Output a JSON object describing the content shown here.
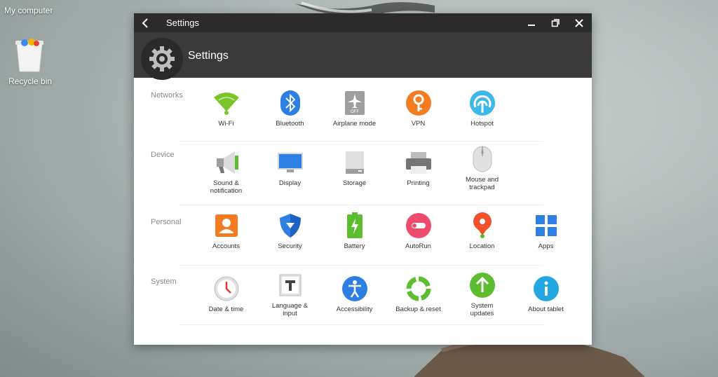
{
  "desktop": {
    "icons": [
      {
        "label": "My computer"
      },
      {
        "label": "Recycle bin"
      }
    ]
  },
  "window": {
    "title": "Settings",
    "header_title": "Settings"
  },
  "sections": [
    {
      "label": "Networks",
      "items": [
        {
          "label": "Wi-Fi",
          "icon": "wifi-icon"
        },
        {
          "label": "Bluetooth",
          "icon": "bluetooth-icon"
        },
        {
          "label": "Airplane mode",
          "icon": "airplane-mode-icon",
          "badge": "OFF"
        },
        {
          "label": "VPN",
          "icon": "vpn-key-icon"
        },
        {
          "label": "Hotspot",
          "icon": "hotspot-icon"
        }
      ]
    },
    {
      "label": "Device",
      "items": [
        {
          "label": "Sound &\nnotification",
          "icon": "megaphone-icon"
        },
        {
          "label": "Display",
          "icon": "monitor-icon"
        },
        {
          "label": "Storage",
          "icon": "storage-drive-icon"
        },
        {
          "label": "Printing",
          "icon": "printer-icon"
        },
        {
          "label": "Mouse and\ntrackpad",
          "icon": "mouse-icon"
        }
      ]
    },
    {
      "label": "Personal",
      "items": [
        {
          "label": "Accounts",
          "icon": "account-icon"
        },
        {
          "label": "Security",
          "icon": "shield-icon"
        },
        {
          "label": "Battery",
          "icon": "battery-icon"
        },
        {
          "label": "AutoRun",
          "icon": "toggle-icon"
        },
        {
          "label": "Location",
          "icon": "location-pin-icon"
        },
        {
          "label": "Apps",
          "icon": "apps-grid-icon"
        }
      ]
    },
    {
      "label": "System",
      "items": [
        {
          "label": "Date & time",
          "icon": "clock-icon"
        },
        {
          "label": "Language &\ninput",
          "icon": "text-t-icon"
        },
        {
          "label": "Accessibility",
          "icon": "accessibility-icon"
        },
        {
          "label": "Backup & reset",
          "icon": "backup-reset-icon"
        },
        {
          "label": "System\nupdates",
          "icon": "update-arrow-icon"
        },
        {
          "label": "About tablet",
          "icon": "info-icon"
        }
      ]
    }
  ],
  "colors": {
    "titlebar": "#2b2b2b",
    "header": "#3a3a3a",
    "wifi": "#7ac62a",
    "bluetooth": "#2d7fe3",
    "vpn": "#f47b20",
    "hotspot": "#3bb8e8",
    "accounts": "#f47b20",
    "security": "#2d7fe3",
    "battery": "#5cbd2f",
    "autorun": "#ef4b6c",
    "location": "#f0502d",
    "apps": "#2d7fe3",
    "accessibility": "#2d7fe3",
    "backup": "#5cbd2f",
    "updates": "#5cbd2f",
    "about": "#23a7e0"
  }
}
